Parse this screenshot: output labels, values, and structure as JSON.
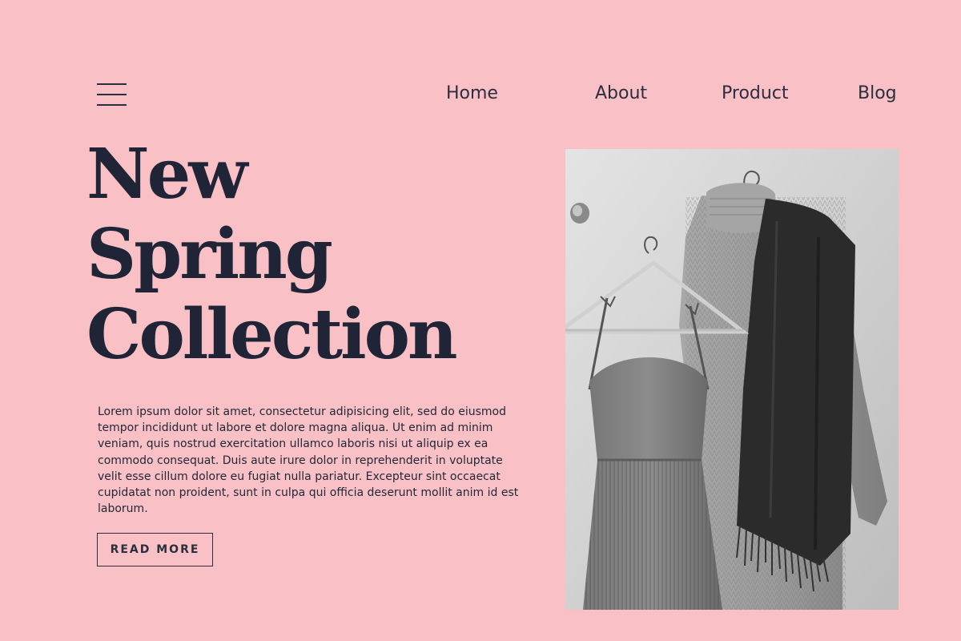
{
  "nav": {
    "menu_icon": "hamburger-menu-icon",
    "links": [
      {
        "label": "Home"
      },
      {
        "label": "About"
      },
      {
        "label": "Product"
      },
      {
        "label": "Blog"
      }
    ]
  },
  "hero": {
    "title_lines": [
      "New",
      "Spring",
      "Collection"
    ],
    "body": "Lorem ipsum dolor sit amet, consectetur adipisicing elit, sed do eiusmod tempor incididunt ut labore et dolore magna aliqua. Ut enim ad minim veniam, quis nostrud exercitation ullamco laboris nisi ut aliquip ex ea commodo consequat. Duis aute irure dolor in reprehenderit in voluptate velit esse cillum dolore eu fugiat nulla pariatur. Excepteur sint occaecat cupidatat non proident, sunt in culpa qui officia deserunt mollit anim id est laborum.",
    "button_label": "READ MORE"
  },
  "colors": {
    "background": "#f9c1c5",
    "text": "#22283a"
  }
}
